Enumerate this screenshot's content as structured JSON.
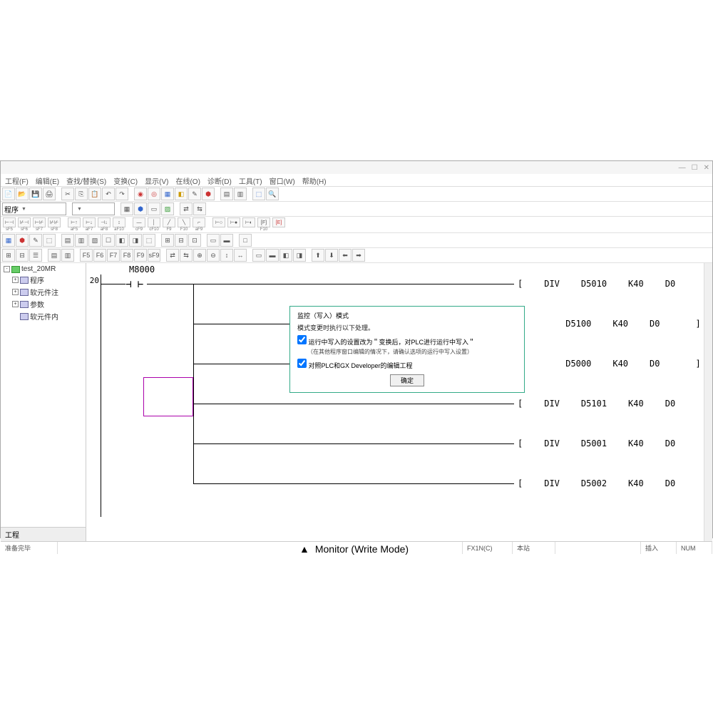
{
  "menubar": [
    "工程(F)",
    "编辑(E)",
    "查找/替换(S)",
    "变换(C)",
    "显示(V)",
    "在线(O)",
    "诊断(D)",
    "工具(T)",
    "窗口(W)",
    "帮助(H)"
  ],
  "combo1": "程序",
  "tree": {
    "root": "test_20MR",
    "items": [
      "程序",
      "软元件注",
      "参数",
      "软元件内"
    ]
  },
  "sidebar_tab": "工程",
  "ladder": {
    "step": "20",
    "contact": "M8000",
    "rows": [
      {
        "op": "DIV",
        "d": "D5010",
        "k": "K40",
        "r": "D0"
      },
      {
        "op": "",
        "d": "D5100",
        "k": "K40",
        "r": "D0"
      },
      {
        "op": "",
        "d": "D5000",
        "k": "K40",
        "r": "D0"
      },
      {
        "op": "DIV",
        "d": "D5101",
        "k": "K40",
        "r": "D0"
      },
      {
        "op": "DIV",
        "d": "D5001",
        "k": "K40",
        "r": "D0"
      },
      {
        "op": "DIV",
        "d": "D5002",
        "k": "K40",
        "r": "D0"
      }
    ]
  },
  "dialog": {
    "title": "监控（写入）模式",
    "line1": "模式变更时执行以下处理。",
    "chk1": "运行中写入的设置改为＂变换后，对PLC进行运行中写入＂",
    "sub1": "（在其他程序窗口编辑的情况下，请确认选项的运行中写入设置）",
    "chk2": "对照PLC和GX Developer的编辑工程",
    "ok": "确定"
  },
  "status": {
    "left": "准备完毕",
    "plc": "FX1N(C)",
    "station": "本站",
    "mode": "插入",
    "num": "NUM"
  },
  "caption": "Monitor (Write Mode)"
}
